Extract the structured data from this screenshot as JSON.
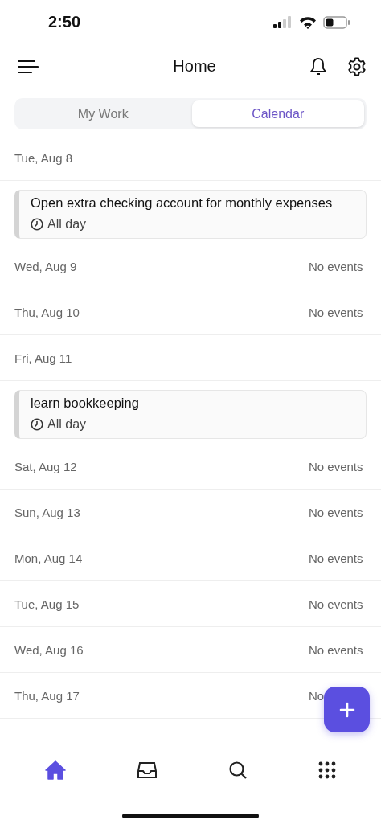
{
  "status_bar": {
    "time": "2:50"
  },
  "header": {
    "title": "Home"
  },
  "tabs": [
    {
      "label": "My Work",
      "selected": false
    },
    {
      "label": "Calendar",
      "selected": true
    }
  ],
  "days": [
    {
      "date": "Tue, Aug 8",
      "events": [
        {
          "title": "Open extra checking account for monthly expenses",
          "time": "All day"
        }
      ]
    },
    {
      "date": "Wed, Aug 9",
      "note": "No events"
    },
    {
      "date": "Thu, Aug 10",
      "note": "No events"
    },
    {
      "date": "Fri, Aug 11",
      "events": [
        {
          "title": "learn bookkeeping",
          "time": "All day"
        }
      ]
    },
    {
      "date": "Sat, Aug 12",
      "note": "No events"
    },
    {
      "date": "Sun, Aug 13",
      "note": "No events"
    },
    {
      "date": "Mon, Aug 14",
      "note": "No events"
    },
    {
      "date": "Tue, Aug 15",
      "note": "No events"
    },
    {
      "date": "Wed, Aug 16",
      "note": "No events"
    },
    {
      "date": "Thu, Aug 17",
      "note": "No"
    }
  ],
  "bottom_nav": [
    {
      "kind": "home",
      "selected": true
    },
    {
      "kind": "inbox",
      "selected": false
    },
    {
      "kind": "search",
      "selected": false
    },
    {
      "kind": "apps",
      "selected": false
    }
  ]
}
